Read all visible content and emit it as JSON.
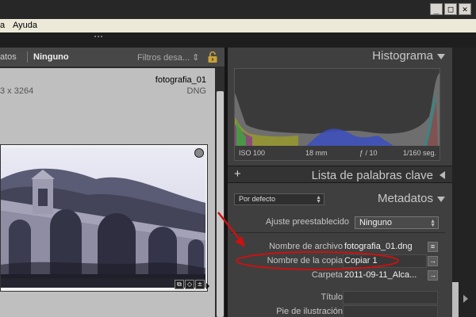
{
  "window": {
    "minimize_glyph": "_",
    "maximize_glyph": "□",
    "close_glyph": "✕"
  },
  "menubar": {
    "items": [
      "a",
      "Ayuda"
    ]
  },
  "filterbar": {
    "cut_text": "atos",
    "active_text": "Ninguno",
    "filter_text": "Filtros desa... ⇕"
  },
  "grid_cell": {
    "filename": "fotografia_01",
    "dimensions": "3 x 3264",
    "format": "DNG"
  },
  "histogram": {
    "title": "Histograma",
    "iso": "ISO 100",
    "focal": "18 mm",
    "aperture": "ƒ / 10",
    "shutter": "1/160 seg."
  },
  "keywords_panel": {
    "plus": "+",
    "title": "Lista de palabras clave"
  },
  "metadata": {
    "title": "Metadatos",
    "preset_select": "Por defecto",
    "preset_label": "Ajuste preestablecido",
    "preset_value": "Ninguno",
    "fields": [
      {
        "label": "Nombre de archivo",
        "value": "fotografia_01.dng",
        "button": "≡"
      },
      {
        "label": "Nombre de la copia",
        "value": "Copiar 1",
        "button": "→"
      },
      {
        "label": "Carpeta",
        "value": "2011-09-11_Alca...",
        "button": "→"
      },
      {
        "label": "Título",
        "value": ""
      },
      {
        "label": "Pie de ilustración",
        "value": ""
      }
    ]
  },
  "colors": {
    "annotation": "#cc1111"
  }
}
